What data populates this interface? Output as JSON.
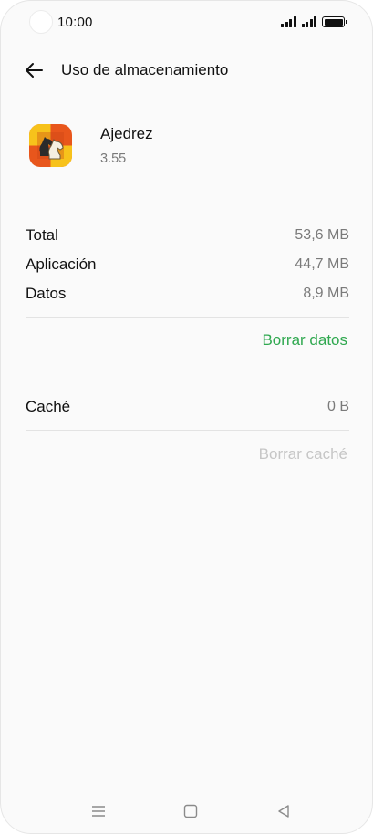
{
  "status_bar": {
    "time": "10:00"
  },
  "header": {
    "title": "Uso de almacenamiento",
    "back_icon": "arrow-left-icon"
  },
  "app": {
    "name": "Ajedrez",
    "version": "3.55",
    "icon": "chess-knight-icon"
  },
  "storage": {
    "rows": [
      {
        "label": "Total",
        "value": "53,6 MB"
      },
      {
        "label": "Aplicación",
        "value": "44,7 MB"
      },
      {
        "label": "Datos",
        "value": "8,9 MB"
      }
    ],
    "clear_data_label": "Borrar datos"
  },
  "cache": {
    "label": "Caché",
    "value": "0 B",
    "clear_cache_label": "Borrar caché"
  },
  "colors": {
    "accent_green": "#2fa84f",
    "disabled_gray": "#c6c6c6",
    "icon_orange": "#e8561c",
    "icon_yellow": "#f7c21b"
  },
  "nav_bar": {
    "menu_icon": "menu-icon",
    "home_icon": "home-square-icon",
    "back_icon": "back-triangle-icon"
  }
}
